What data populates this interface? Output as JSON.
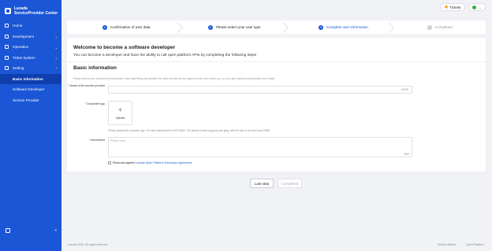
{
  "brand": {
    "line1": "Lazada",
    "line2": "ServiceProvider Center"
  },
  "sidebar": {
    "items": [
      {
        "label": "Home",
        "icon": "home-icon",
        "chevron": false
      },
      {
        "label": "Development",
        "icon": "code-icon",
        "chevron": true
      },
      {
        "label": "Operation",
        "icon": "operation-icon",
        "chevron": true
      },
      {
        "label": "Ticket System",
        "icon": "ticket-icon",
        "chevron": true
      },
      {
        "label": "Setting",
        "icon": "gear-icon",
        "chevron": true
      }
    ],
    "sub_items": [
      {
        "label": "Basic information",
        "active": true
      },
      {
        "label": "Software Developer",
        "active": false
      },
      {
        "label": "Service Provider",
        "active": false
      }
    ],
    "chevron_glyph": "⌄",
    "collapse_glyph": "«"
  },
  "topbar": {
    "tickets_label": "Tickets",
    "user_chevron": "⌄"
  },
  "steps": [
    {
      "num": "1",
      "label": "Confirmation of user data",
      "state": "done"
    },
    {
      "num": "2",
      "label": "Please select your user type",
      "state": "done"
    },
    {
      "num": "3",
      "label": "Complete user information",
      "state": "active"
    },
    {
      "num": "4",
      "label": "Completed",
      "state": "pending"
    }
  ],
  "main": {
    "welcome_title": "Welcome to become a software developer",
    "welcome_sub": "You can become a developer and have the ability to call open platform APIs by completing the following steps",
    "basic_title": "Basic information",
    "notice": "Please perfect your enterprise personal data. Clear data filling may facilitate the seller and the service agent to know more about you, so as to get business opportunities more easily.",
    "name_label": "Name of the service provider",
    "name_value": "",
    "name_counter": "0/100",
    "logo_label": "Corporate logo",
    "upload_plus": "+",
    "upload_label": "Upload",
    "logo_hint": "Please upload the corporate logo. The size requirement is 200*200px. The picture format is jpg,png and jpeg, with the size of no more than 10MB.",
    "intro_label": "Introduction",
    "intro_placeholder": "Please input",
    "intro_counter": "0/50",
    "agree_text": "Read and agreed",
    "agree_link": "Lazada Open Platform Developer Agreement",
    "required_mark": "*"
  },
  "buttons": {
    "last_step": "Last step",
    "completed": "Completed"
  },
  "footer": {
    "copyright": "Lazada 2022, All rights reserved.",
    "link1": "Service Market",
    "link2": "Open Platform"
  },
  "colors": {
    "brand_blue": "#1a56d6",
    "active_nav": "#0f3fae",
    "required": "#e74c3c"
  }
}
